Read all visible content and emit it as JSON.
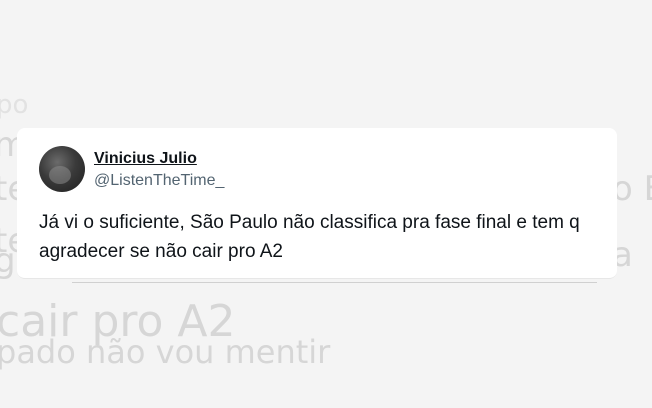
{
  "background_text": [
    "po",
    "me",
    "te",
    "te",
    "ga",
    "o E",
    "a",
    "cair pro A2",
    "pado não vou mentir"
  ],
  "tweet": {
    "display_name": "Vinicius Julio",
    "handle": "@ListenTheTime_",
    "text": "Já vi o suficiente, São Paulo não classifica pra fase final e tem q agradecer se não cair pro A2"
  },
  "colors": {
    "text_primary": "#0f1419",
    "text_secondary": "#536471",
    "card_background": "#ffffff",
    "page_background": "#f4f4f4"
  },
  "icons": {
    "avatar": "profile-avatar"
  }
}
